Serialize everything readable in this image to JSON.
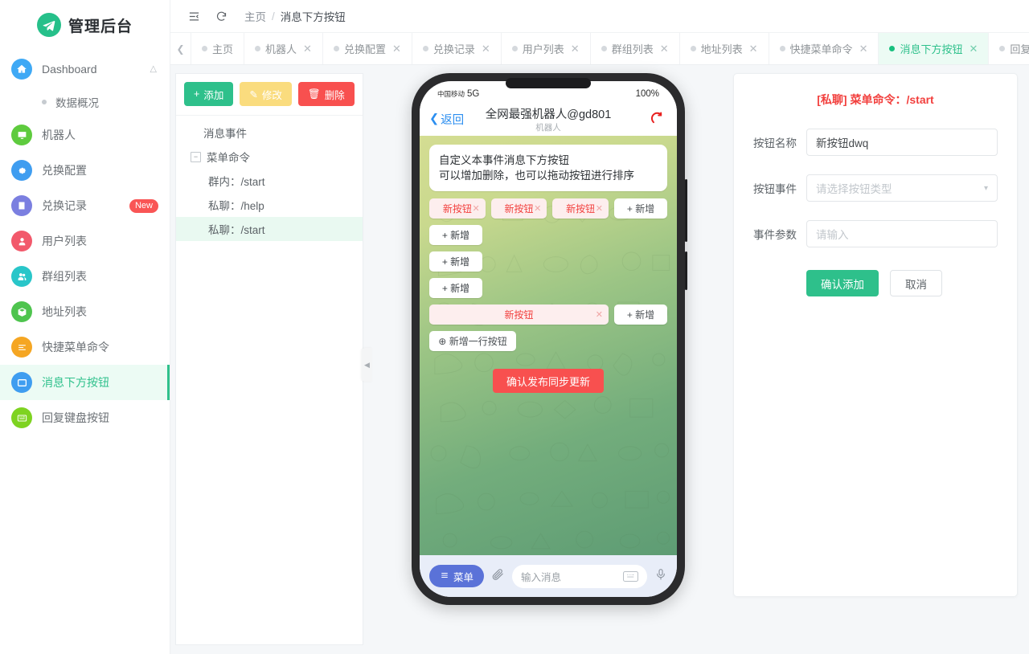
{
  "brand": {
    "title": "管理后台",
    "logo_icon": "telegram-icon",
    "logo_color": "#26c08a"
  },
  "sidebar": {
    "dashboard": {
      "label": "Dashboard",
      "icon": "home-icon",
      "color": "#3fa9f5",
      "chevron": "chevron-up-icon"
    },
    "subitems": [
      {
        "label": "数据概况"
      }
    ],
    "items": [
      {
        "label": "机器人",
        "icon": "monitor-icon",
        "color": "#5ecb3e",
        "badge": ""
      },
      {
        "label": "兑换配置",
        "icon": "gear-icon",
        "color": "#3f9df0",
        "badge": ""
      },
      {
        "label": "兑换记录",
        "icon": "book-icon",
        "color": "#7b7fe0",
        "badge": "New"
      },
      {
        "label": "用户列表",
        "icon": "user-icon",
        "color": "#f2596b",
        "badge": ""
      },
      {
        "label": "群组列表",
        "icon": "group-icon",
        "color": "#29c6c9",
        "badge": ""
      },
      {
        "label": "地址列表",
        "icon": "box-icon",
        "color": "#4ec44e",
        "badge": ""
      },
      {
        "label": "快捷菜单命令",
        "icon": "list-icon",
        "color": "#f5a623",
        "badge": ""
      },
      {
        "label": "消息下方按钮",
        "icon": "window-icon",
        "color": "#3f9df0",
        "badge": "",
        "active": true
      },
      {
        "label": "回复键盘按钮",
        "icon": "keyboard-icon",
        "color": "#7ed321",
        "badge": ""
      }
    ]
  },
  "topbar": {
    "collapse_icon": "menu-fold-icon",
    "refresh_icon": "refresh-icon",
    "breadcrumb": {
      "root": "主页",
      "sep": "/",
      "current": "消息下方按钮"
    }
  },
  "tabs": {
    "prev_arrow": "chevron-left-icon",
    "items": [
      {
        "label": "主页",
        "closable": false
      },
      {
        "label": "机器人",
        "closable": true
      },
      {
        "label": "兑换配置",
        "closable": true
      },
      {
        "label": "兑换记录",
        "closable": true
      },
      {
        "label": "用户列表",
        "closable": true
      },
      {
        "label": "群组列表",
        "closable": true
      },
      {
        "label": "地址列表",
        "closable": true
      },
      {
        "label": "快捷菜单命令",
        "closable": true
      },
      {
        "label": "消息下方按钮",
        "closable": true,
        "active": true
      },
      {
        "label": "回复键盘按钮",
        "closable": true
      }
    ]
  },
  "tree_panel": {
    "toolbar": {
      "add": "添加",
      "add_icon": "plus-icon",
      "edit": "修改",
      "edit_icon": "pencil-icon",
      "delete": "删除",
      "delete_icon": "trash-icon"
    },
    "nodes": [
      {
        "label": "消息事件",
        "level": 1,
        "toggle": false,
        "selected": false
      },
      {
        "label": "菜单命令",
        "level": 1,
        "toggle": true,
        "toggle_glyph": "−",
        "selected": false
      },
      {
        "label": "群内：/start",
        "level": 2,
        "toggle": false,
        "selected": false
      },
      {
        "label": "私聊：/help",
        "level": 2,
        "toggle": false,
        "selected": false
      },
      {
        "label": "私聊：/start",
        "level": 2,
        "toggle": false,
        "selected": true
      }
    ]
  },
  "collapse_handle": {
    "icon": "caret-left-icon"
  },
  "phone": {
    "status": {
      "carrier": "中国移动",
      "network": "5G",
      "battery": "100%"
    },
    "header": {
      "back": "返回",
      "back_icon": "chevron-left-icon",
      "title": "全网最强机器人@gd801",
      "subtitle": "机器人",
      "avatar_icon": "telegram-red-icon"
    },
    "message": "自定义本事件消息下方按钮\n可以增加删除，也可以拖动按钮进行排序",
    "message_line1": "自定义本事件消息下方按钮",
    "message_line2": "可以增加删除，也可以拖动按钮进行排序",
    "keyboard_rows": [
      {
        "buttons": [
          {
            "label": "新按钮",
            "type": "named"
          },
          {
            "label": "新按钮",
            "type": "named"
          },
          {
            "label": "新按钮",
            "type": "named"
          }
        ],
        "add_label": "新增"
      },
      {
        "buttons": [],
        "add_label": "新增"
      },
      {
        "buttons": [],
        "add_label": "新增"
      },
      {
        "buttons": [],
        "add_label": "新增"
      },
      {
        "buttons": [
          {
            "label": "新按钮",
            "type": "named"
          }
        ],
        "add_label": "新增"
      }
    ],
    "add_row_label": "新增一行按钮",
    "add_row_icon": "plus-circle-icon",
    "publish_label": "确认发布同步更新",
    "input_bar": {
      "menu_label": "菜单",
      "menu_icon": "hamburger-icon",
      "attach_icon": "paperclip-icon",
      "placeholder": "输入消息",
      "keyboard_icon": "keyboard-icon",
      "mic_icon": "microphone-icon"
    }
  },
  "form": {
    "title_prefix": "[私聊]",
    "title_rest": "菜单命令：/start",
    "title": "[私聊]  菜单命令：/start",
    "rows": [
      {
        "label": "按钮名称",
        "value": "新按钮dwq",
        "placeholder": "",
        "type": "text"
      },
      {
        "label": "按钮事件",
        "value": "",
        "placeholder": "请选择按钮类型",
        "type": "select"
      },
      {
        "label": "事件参数",
        "value": "",
        "placeholder": "请输入",
        "type": "text"
      }
    ],
    "confirm": "确认添加",
    "cancel": "取消"
  },
  "colors": {
    "accent_green": "#2ec08b",
    "danger_red": "#f8504f",
    "warn_yellow": "#fadc7e",
    "tab_active_bg": "#ecfbf4"
  }
}
